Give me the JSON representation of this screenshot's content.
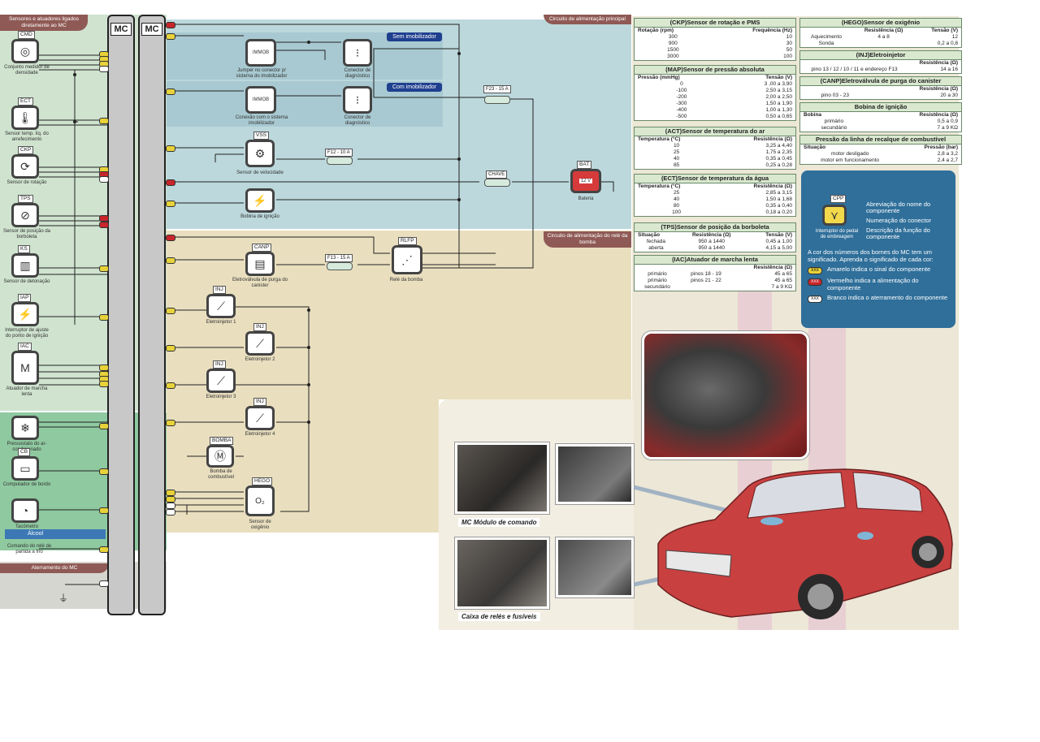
{
  "sections": {
    "left_header": "Sensores e atuadores ligados diretamente ao MC",
    "top_right_header": "Circuito de alimentação principal",
    "mid_right_header": "Circuito de alimentação do relé da bomba",
    "alcool": "Álcool",
    "aterramento": "Aterramento do MC",
    "sem_imob": "Sem imobilizador",
    "com_imob": "Com imobilizador",
    "mc1": "MC",
    "mc2": "MC"
  },
  "left_components": [
    {
      "abbr": "CMD",
      "icon": "pressure-icon",
      "glyph": "◎",
      "label": "Conjunto medidor de densidade"
    },
    {
      "abbr": "ECT",
      "icon": "thermometer-icon",
      "glyph": "🌡",
      "label": "Sensor temp. líq. do arrefecimento"
    },
    {
      "abbr": "CKP",
      "icon": "rotation-icon",
      "glyph": "⟳",
      "label": "Sensor de rotação"
    },
    {
      "abbr": "TPS",
      "icon": "throttle-icon",
      "glyph": "⊘",
      "label": "Sensor de posição da borboleta"
    },
    {
      "abbr": "KS",
      "icon": "knock-icon",
      "glyph": "▥",
      "label": "Sensor de detonação"
    },
    {
      "abbr": "IAP",
      "icon": "ignition-switch-icon",
      "glyph": "⚡",
      "label": "Interruptor de ajuste do ponto de ignição"
    },
    {
      "abbr": "IAC",
      "icon": "motor-icon",
      "glyph": "M",
      "label": "Atuador de marcha lenta"
    },
    {
      "abbr": "",
      "icon": "ac-icon",
      "glyph": "❄",
      "label": "Pressostato do ar-condicionado"
    },
    {
      "abbr": "CB",
      "icon": "computer-icon",
      "glyph": "▭",
      "label": "Computador de bordo"
    },
    {
      "abbr": "",
      "icon": "tachometer-icon",
      "glyph": "◔",
      "label": "Tacômetro"
    }
  ],
  "alcool_label": "Comando do relé de partida a frio",
  "mid_components": {
    "immob1": {
      "abbr": "IMMOB",
      "label": "Jumper no conector p/ sistema do imobilizador"
    },
    "diag1": {
      "label": "Conector de diagnóstico"
    },
    "immob2": {
      "abbr": "IMMOB",
      "label": "Conexão com o sistema imobilizador"
    },
    "diag2": {
      "label": "Conector de diagnóstico"
    },
    "vss": {
      "abbr": "VSS",
      "label": "Sensor de velocidade"
    },
    "coil": {
      "label": "Bobina de ignição"
    },
    "bat": {
      "abbr": "BAT",
      "value": "12 V",
      "label": "Bateria"
    },
    "canp": {
      "abbr": "CANP",
      "label": "Eletroválvula de purga do canister"
    },
    "rlfp": {
      "abbr": "RLFP",
      "label": "Relé da bomba"
    },
    "inj1": {
      "abbr": "INJ",
      "label": "Eletroinjetor 1"
    },
    "inj2": {
      "abbr": "INJ",
      "label": "Eletroinjetor 2"
    },
    "inj3": {
      "abbr": "INJ",
      "label": "Eletroinjetor 3"
    },
    "inj4": {
      "abbr": "INJ",
      "label": "Eletroinjetor 4"
    },
    "bomba": {
      "abbr": "BOMBA",
      "label": "Bomba de combustível"
    },
    "hego": {
      "abbr": "HEGO",
      "value": "O₂",
      "label": "Sensor de oxigênio"
    }
  },
  "fuses": {
    "f23": "F23 - 15 A",
    "f12": "F12 - 10 A",
    "chave": "CHAVE",
    "f13": "F13 - 15 A"
  },
  "tables": {
    "ckp": {
      "title": "(CKP)Sensor de rotação e PMS",
      "headers": [
        "Rotação (rpm)",
        "Frequência (Hz)"
      ],
      "rows": [
        [
          "300",
          "10"
        ],
        [
          "900",
          "30"
        ],
        [
          "1500",
          "50"
        ],
        [
          "3000",
          "100"
        ]
      ]
    },
    "map": {
      "title": "(MAP)Sensor de pressão absoluta",
      "headers": [
        "Pressão (mmHg)",
        "Tensão (V)"
      ],
      "rows": [
        [
          "0",
          "3 ,00 a 3,90"
        ],
        [
          "-100",
          "2,50 a 3,15"
        ],
        [
          "-200",
          "2,00 a 2,50"
        ],
        [
          "-300",
          "1,50 a 1,90"
        ],
        [
          "-400",
          "1,00 a 1,30"
        ],
        [
          "-500",
          "0,50 a 0,65"
        ]
      ]
    },
    "act": {
      "title": "(ACT)Sensor de temperatura do ar",
      "headers": [
        "Temperatura (°C)",
        "Resistência (Ω)"
      ],
      "rows": [
        [
          "10",
          "3,25 a 4,40"
        ],
        [
          "25",
          "1,75 a 2,35"
        ],
        [
          "40",
          "0,35 a 0,45"
        ],
        [
          "85",
          "0,25 a 0,28"
        ]
      ]
    },
    "ect": {
      "title": "(ECT)Sensor de temperatura da água",
      "headers": [
        "Temperatura (°C)",
        "Resistência (Ω)"
      ],
      "rows": [
        [
          "25",
          "2,85 a 3,15"
        ],
        [
          "40",
          "1,50 a 1,68"
        ],
        [
          "80",
          "0,35 a 0,40"
        ],
        [
          "100",
          "0,18 a 0,20"
        ]
      ]
    },
    "tps": {
      "title": "(TPS)Sensor de posição da borboleta",
      "headers": [
        "Situação",
        "Resistência (Ω)",
        "Tensão (V)"
      ],
      "rows": [
        [
          "fechada",
          "950 a 1440",
          "0,45 a 1,00"
        ],
        [
          "aberta",
          "950 a 1440",
          "4,15 a 5,00"
        ]
      ]
    },
    "iac": {
      "title": "(IAC)Atuador de marcha lenta",
      "headers": [
        "",
        "",
        "Resistência (Ω)"
      ],
      "rows": [
        [
          "primário",
          "pinos 18 - 19",
          "45 a 65"
        ],
        [
          "primário",
          "pinos 21 - 22",
          "45 a 65"
        ],
        [
          "secundário",
          "",
          "7 a 9 KΩ"
        ]
      ]
    },
    "hego": {
      "title": "(HEGO)Sensor de oxigênio",
      "headers": [
        "",
        "Resistência (Ω)",
        "Tensão (V)"
      ],
      "rows": [
        [
          "Aquecimento",
          "4 a 8",
          "12"
        ],
        [
          "Sonda",
          "",
          "0,2 a 0,8"
        ]
      ]
    },
    "inj": {
      "title": "(INJ)Eletroinjetor",
      "headers": [
        "",
        "Resistência (Ω)"
      ],
      "rows": [
        [
          "pino 13 / 12 / 10 / 11 e endereço F13",
          "14 a 16"
        ]
      ]
    },
    "canp": {
      "title": "(CANP)Eletroválvula de purga do canister",
      "headers": [
        "",
        "Resistência (Ω)"
      ],
      "rows": [
        [
          "pino 03 - 23",
          "20 a 30"
        ]
      ]
    },
    "bobina": {
      "title": "Bobina de ignição",
      "headers": [
        "Bobina",
        "Resistência (Ω)"
      ],
      "rows": [
        [
          "primário",
          "0,5 a 0,9"
        ],
        [
          "secundário",
          "7 a 9 KΩ"
        ]
      ]
    },
    "pressao": {
      "title": "Pressão da linha de recalque de combustível",
      "headers": [
        "Situação",
        "Pressão (bar)"
      ],
      "rows": [
        [
          "motor desligado",
          "2,8 a 3,2"
        ],
        [
          "motor em funcionamento",
          "2,4 a 2,7"
        ]
      ]
    }
  },
  "legend": {
    "cpp": "CPP",
    "cpp_label": "Interruptor do pedal de embreagem",
    "abbr_desc": "Abreviação do nome do componente",
    "conn_desc": "Numeração do conector",
    "func_desc": "Descrição da função do componente",
    "intro": "A cor dos números dos bornes do MC tem um significado. Aprenda o significado de cada cor:",
    "yellow": "Amarelo indica o sinal do componente",
    "red": "Vermelho indica a alimentação do componente",
    "white": "Branco indica o aterramento do componente",
    "badge_text": "XXX",
    "colors": {
      "yellow": "#e8d23a",
      "red": "#c8262a",
      "white": "#ffffff",
      "bg": "#2f6f9a"
    }
  },
  "captions": {
    "mc_abbr": "MC",
    "mc": "Módulo de comando",
    "relay": "Caixa de relés e fusíveis"
  }
}
